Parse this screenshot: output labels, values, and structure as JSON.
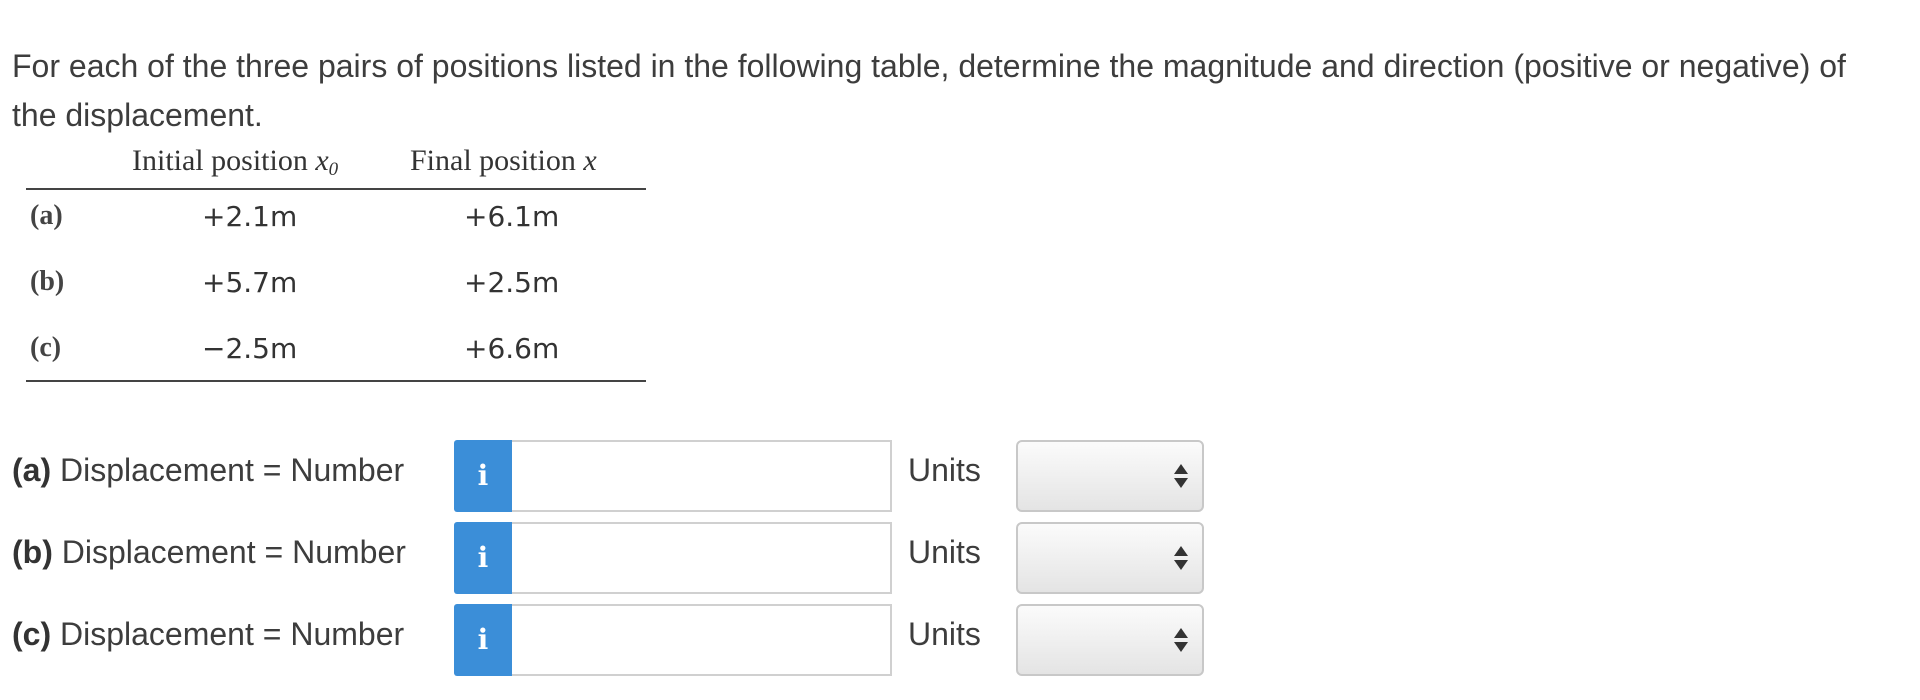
{
  "question": {
    "text": "For each of the three pairs of positions listed in the following table, determine the magnitude and direction (positive or negative) of the displacement."
  },
  "table": {
    "headers": {
      "initial_label": "Initial position ",
      "initial_var": "x",
      "initial_sub": "0",
      "final_label": "Final position ",
      "final_var": "x"
    },
    "rows": [
      {
        "label": "(a)",
        "initial": "+2.1m",
        "final": "+6.1m"
      },
      {
        "label": "(b)",
        "initial": "+5.7m",
        "final": "+2.5m"
      },
      {
        "label": "(c)",
        "initial": "−2.5m",
        "final": "+6.6m"
      }
    ]
  },
  "answers": [
    {
      "part": "(a)",
      "label": " Displacement = Number",
      "info_icon": "i",
      "value": "",
      "units_label": "Units",
      "units_value": ""
    },
    {
      "part": "(b)",
      "label": " Displacement = Number",
      "info_icon": "i",
      "value": "",
      "units_label": "Units",
      "units_value": ""
    },
    {
      "part": "(c)",
      "label": " Displacement = Number",
      "info_icon": "i",
      "value": "",
      "units_label": "Units",
      "units_value": ""
    }
  ],
  "colors": {
    "info_button": "#3b8ed8",
    "text": "#3d3d3d"
  }
}
